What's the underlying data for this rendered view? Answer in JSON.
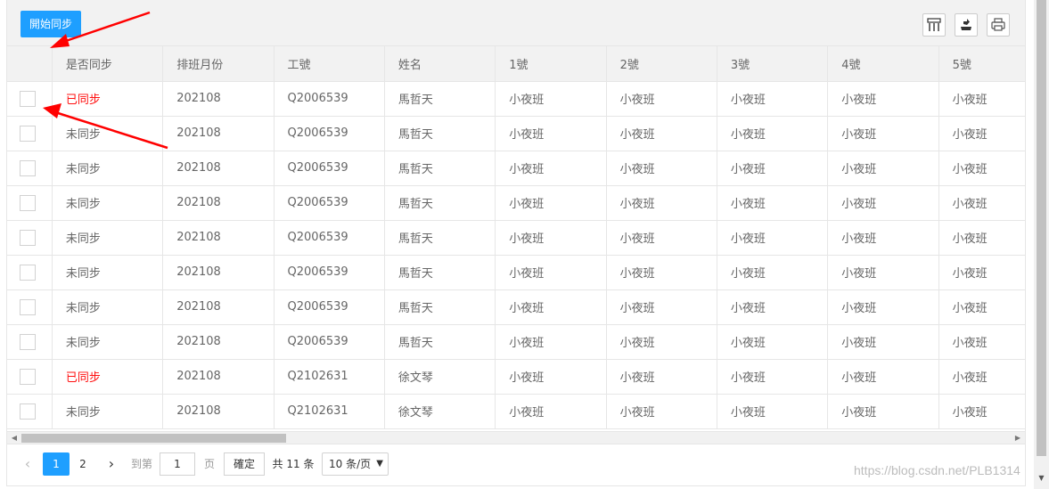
{
  "toolbar": {
    "sync_button": "開始同步",
    "icons": [
      "columns-icon",
      "export-icon",
      "print-icon"
    ]
  },
  "table": {
    "columns": [
      "是否同步",
      "排班月份",
      "工號",
      "姓名",
      "1號",
      "2號",
      "3號",
      "4號",
      "5號"
    ],
    "rows": [
      {
        "status": "已同步",
        "synced": true,
        "month": "202108",
        "id": "Q2006539",
        "name": "馬哲天",
        "d1": "小夜班",
        "d2": "小夜班",
        "d3": "小夜班",
        "d4": "小夜班",
        "d5": "小夜班"
      },
      {
        "status": "未同步",
        "synced": false,
        "month": "202108",
        "id": "Q2006539",
        "name": "馬哲天",
        "d1": "小夜班",
        "d2": "小夜班",
        "d3": "小夜班",
        "d4": "小夜班",
        "d5": "小夜班"
      },
      {
        "status": "未同步",
        "synced": false,
        "month": "202108",
        "id": "Q2006539",
        "name": "馬哲天",
        "d1": "小夜班",
        "d2": "小夜班",
        "d3": "小夜班",
        "d4": "小夜班",
        "d5": "小夜班"
      },
      {
        "status": "未同步",
        "synced": false,
        "month": "202108",
        "id": "Q2006539",
        "name": "馬哲天",
        "d1": "小夜班",
        "d2": "小夜班",
        "d3": "小夜班",
        "d4": "小夜班",
        "d5": "小夜班"
      },
      {
        "status": "未同步",
        "synced": false,
        "month": "202108",
        "id": "Q2006539",
        "name": "馬哲天",
        "d1": "小夜班",
        "d2": "小夜班",
        "d3": "小夜班",
        "d4": "小夜班",
        "d5": "小夜班"
      },
      {
        "status": "未同步",
        "synced": false,
        "month": "202108",
        "id": "Q2006539",
        "name": "馬哲天",
        "d1": "小夜班",
        "d2": "小夜班",
        "d3": "小夜班",
        "d4": "小夜班",
        "d5": "小夜班"
      },
      {
        "status": "未同步",
        "synced": false,
        "month": "202108",
        "id": "Q2006539",
        "name": "馬哲天",
        "d1": "小夜班",
        "d2": "小夜班",
        "d3": "小夜班",
        "d4": "小夜班",
        "d5": "小夜班"
      },
      {
        "status": "未同步",
        "synced": false,
        "month": "202108",
        "id": "Q2006539",
        "name": "馬哲天",
        "d1": "小夜班",
        "d2": "小夜班",
        "d3": "小夜班",
        "d4": "小夜班",
        "d5": "小夜班"
      },
      {
        "status": "已同步",
        "synced": true,
        "month": "202108",
        "id": "Q2102631",
        "name": "徐文琴",
        "d1": "小夜班",
        "d2": "小夜班",
        "d3": "小夜班",
        "d4": "小夜班",
        "d5": "小夜班"
      },
      {
        "status": "未同步",
        "synced": false,
        "month": "202108",
        "id": "Q2102631",
        "name": "徐文琴",
        "d1": "小夜班",
        "d2": "小夜班",
        "d3": "小夜班",
        "d4": "小夜班",
        "d5": "小夜班"
      }
    ]
  },
  "pager": {
    "current": "1",
    "page2": "2",
    "goto_label": "到第",
    "goto_value": "1",
    "page_label": "页",
    "confirm": "確定",
    "total": "共 11 条",
    "page_size": "10 条/页"
  },
  "watermark": "https://blog.csdn.net/PLB1314",
  "colors": {
    "accent": "#1e9fff",
    "synced_text": "#ff1010",
    "annotation_arrow": "#ff0000"
  }
}
